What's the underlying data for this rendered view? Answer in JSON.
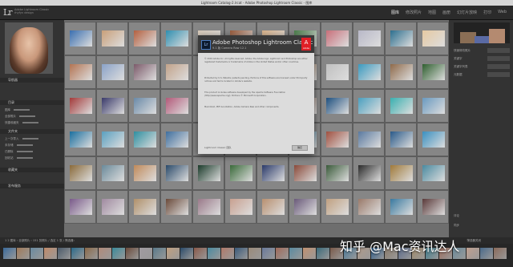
{
  "window_title": "Lightroom Catalog-2.lrcat - Adobe Photoshop Lightroom Classic - 图库",
  "app": {
    "logo": "Lr",
    "identity_line1": "Adobe Lightroom Classic",
    "identity_line2": "rhyfyn design"
  },
  "modules": [
    "图库",
    "修改照片",
    "地图",
    "画册",
    "幻灯片放映",
    "打印",
    "Web"
  ],
  "left_panel": {
    "headers": [
      "导航器",
      "目录",
      "文件夹",
      "收藏夹",
      "发布服务"
    ],
    "folder_rows": [
      "图库",
      "全部照片",
      "快捷收藏夹",
      "上一次导入",
      "未存储",
      "已删除",
      "回收站"
    ]
  },
  "right_panel": {
    "histogram_label": "直方图",
    "rows": [
      "快速修改照片",
      "关键字",
      "关键字列表",
      "元数据",
      "评论",
      "同步"
    ]
  },
  "dialog": {
    "logo": "Lr",
    "title": "Adobe Photoshop Lightroom Classic",
    "version": "9.1 版  Camera Raw 12.1",
    "adobe": "A",
    "adobe_label": "Adobe",
    "paragraphs": [
      "© 2019 Adobe Inc. All rights reserved. Adobe, the Adobe logo, Lightroom and Photoshop are either registered trademarks or trademarks of Adobe in the United States and/or other countries.",
      "Protected by U.S. Patents; patents pending. Portions of this software are licensed under third-party notices and terms located in Adobe's website.",
      "This product includes software developed by the Apache Software Foundation (http://www.apache.org/). Portions © Microsoft Corporation.",
      "Macintosh, PDF-Annotation, Adobe Camera Raw and other components."
    ],
    "credits": "Lightroom Classic 团队",
    "button": "确定"
  },
  "status_bar": {
    "left": "1  2  图库 › 全部照片 › 151 张照片 / 选定 1 张 / 筛选器：",
    "right": "筛选器关闭"
  },
  "watermark": "知乎 @Mac资讯达人",
  "thumb_colors": [
    "#3a6fb0",
    "#c9a07a",
    "#b46040",
    "#2f8fb0",
    "#d8c9b8",
    "#9a5b3b",
    "#d9b28a",
    "#4a7f4a",
    "#c86f7a",
    "#b8b8c8",
    "#2d6f8f",
    "#e6c9a2",
    "#b37452",
    "#8aa2c8",
    "#7c5a6a",
    "#c2a38a",
    "#3c8bb4",
    "#e0d0c0",
    "#5f4a3a",
    "#a07a5a",
    "#c0c0c0",
    "#3a9ac0",
    "#8f6a4a",
    "#2f5f2f",
    "#a33a3a",
    "#3a3a6a",
    "#6a8aa8",
    "#b35a7a",
    "#4a3a6a",
    "#c9a08a",
    "#2a7aaa",
    "#8a6a5a",
    "#1e4f7f",
    "#4aa0c0",
    "#3ab0b0",
    "#6a9ac0",
    "#1a6f9f",
    "#5aa0c0",
    "#2f8fa0",
    "#3f6f9f",
    "#b08040",
    "#4aa0d0",
    "#3a8ab0",
    "#2f6f8f",
    "#a05040",
    "#5a7aa0",
    "#2a5a8a",
    "#3a90c0",
    "#8a6a3a",
    "#6a8a9a",
    "#c08a5a",
    "#2a4a6a",
    "#1a3a2a",
    "#3a6a3a",
    "#2a3a6a",
    "#8a4a3a",
    "#3a5a3a",
    "#2a2a2a",
    "#a07a3a",
    "#4a8aa0",
    "#7a5a8a",
    "#a08aa0",
    "#b0906a",
    "#6a4a3a",
    "#9a7a8a",
    "#c8a090",
    "#b89070",
    "#6a5a7a",
    "#c0a080",
    "#9a7a6a",
    "#3a7aa0",
    "#5a3a3a"
  ],
  "film_colors": [
    "#3a6a9a",
    "#a07a5a",
    "#6a8aa0",
    "#c08a6a",
    "#4a5a6a",
    "#2a6a8a",
    "#8a6a4a",
    "#b08a7a",
    "#3a8a9a",
    "#6a4a3a",
    "#a09aa0",
    "#5a7a8a",
    "#c0a080",
    "#2a4a6a",
    "#8a5a4a",
    "#4a8aa0",
    "#b07a6a",
    "#3a5a7a",
    "#9a8a7a",
    "#6a7a9a",
    "#a06a5a",
    "#5a8aa0",
    "#c09070",
    "#3a6a7a",
    "#7a5a4a",
    "#4a7a9a",
    "#b09a8a",
    "#2a5a8a",
    "#8a7a6a",
    "#5a6a8a",
    "#a08a6a",
    "#3a7a8a",
    "#9a6a5a",
    "#6a8a9a",
    "#c0a090",
    "#4a6a8a",
    "#8a6a5a"
  ]
}
